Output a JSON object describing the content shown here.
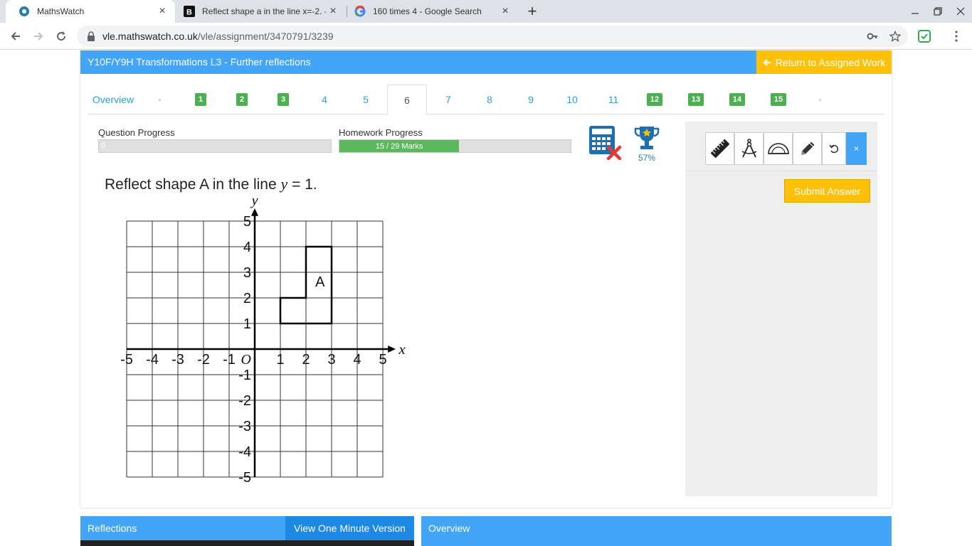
{
  "browser": {
    "tabs": [
      {
        "title": "MathsWatch",
        "icon": "mathswatch-icon"
      },
      {
        "title": "Reflect shape a in the line x=-2. -",
        "icon": "brainly-icon"
      },
      {
        "title": "160 times 4 - Google Search",
        "icon": "google-icon"
      }
    ],
    "url_host": "vle.mathswatch.co.uk",
    "url_path": "/vle/assignment/3470791/3239"
  },
  "header": {
    "title": "Y10F/Y9H Transformations L3 - Further reflections",
    "return_label": "Return to Assigned Work"
  },
  "nav": {
    "overview_label": "Overview",
    "items": [
      {
        "label": "1",
        "completed": true
      },
      {
        "label": "2",
        "completed": true
      },
      {
        "label": "3",
        "completed": true
      },
      {
        "label": "4",
        "completed": false
      },
      {
        "label": "5",
        "completed": false
      },
      {
        "label": "6",
        "completed": false,
        "active": true
      },
      {
        "label": "7",
        "completed": false
      },
      {
        "label": "8",
        "completed": false
      },
      {
        "label": "9",
        "completed": false
      },
      {
        "label": "10",
        "completed": false
      },
      {
        "label": "11",
        "completed": false
      },
      {
        "label": "12",
        "completed": true
      },
      {
        "label": "13",
        "completed": true
      },
      {
        "label": "14",
        "completed": true
      },
      {
        "label": "15",
        "completed": true
      }
    ]
  },
  "progress": {
    "question_label": "Question Progress",
    "question_value": "0",
    "question_fraction": 0,
    "homework_label": "Homework Progress",
    "homework_text": "15 / 29 Marks",
    "homework_fraction": 0.5172,
    "score_percent": "57%"
  },
  "question": {
    "prefix": "Reflect shape A in the line ",
    "var": "y",
    "suffix": " = 1."
  },
  "graph": {
    "x_label": "x",
    "y_label": "y",
    "origin_label": "O",
    "x_ticks": [
      "-5",
      "-4",
      "-3",
      "-2",
      "-1",
      "1",
      "2",
      "3",
      "4",
      "5"
    ],
    "y_ticks": [
      "5",
      "4",
      "3",
      "2",
      "1",
      "-1",
      "-2",
      "-3",
      "-4",
      "-5"
    ],
    "shape_label": "A",
    "shape_vertices": [
      [
        1,
        1
      ],
      [
        3,
        1
      ],
      [
        3,
        4
      ],
      [
        2,
        4
      ],
      [
        2,
        2
      ],
      [
        1,
        2
      ]
    ]
  },
  "tools": {
    "close_label": "×",
    "submit_label": "Submit Answer"
  },
  "bottom": {
    "video_title": "Reflections",
    "video_button": "View One Minute Version",
    "overview_title": "Overview"
  },
  "colors": {
    "primary": "#42a5f5",
    "accent": "#ffc107",
    "success": "#4caf50"
  }
}
